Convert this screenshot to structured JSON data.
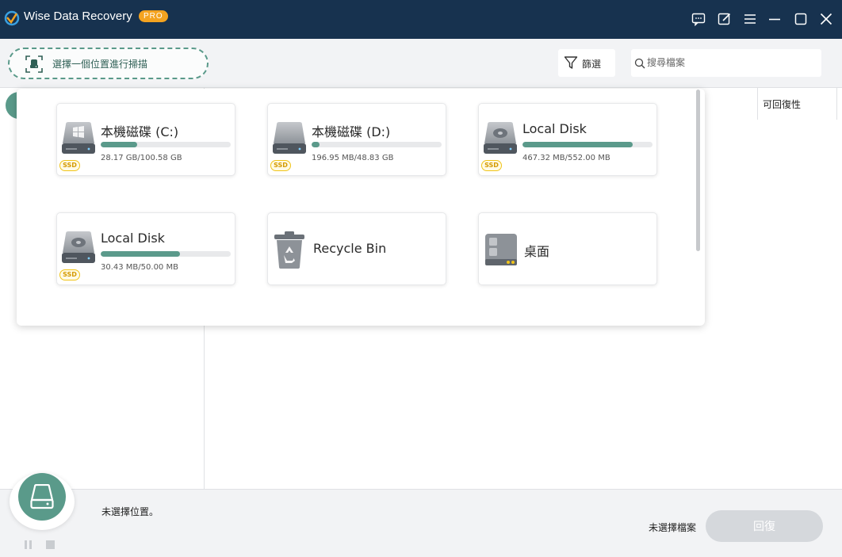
{
  "app": {
    "title": "Wise Data Recovery",
    "badge": "PRO"
  },
  "window_icons": [
    "feedback-icon",
    "edit-icon",
    "menu-icon",
    "minimize-icon",
    "maximize-icon",
    "close-icon"
  ],
  "toolbar": {
    "location_label": "選擇一個位置進行掃描",
    "filter_label": "篩選",
    "search_placeholder": "搜尋檔案"
  },
  "table": {
    "column_recoverability": "可回復性"
  },
  "drives": [
    {
      "name": "本機磁碟 (C:)",
      "size": "28.17 GB/100.58 GB",
      "usage": 0.28,
      "badge": "SSD",
      "icon": "windows-drive-icon"
    },
    {
      "name": "本機磁碟 (D:)",
      "size": "196.95 MB/48.83 GB",
      "usage": 0.06,
      "badge": "SSD",
      "icon": "hard-drive-icon"
    },
    {
      "name": "Local Disk",
      "size": "467.32 MB/552.00 MB",
      "usage": 0.85,
      "badge": "SSD",
      "icon": "hard-drive-icon"
    },
    {
      "name": "Local Disk",
      "size": "30.43 MB/50.00 MB",
      "usage": 0.61,
      "badge": "SSD",
      "icon": "hard-drive-icon"
    },
    {
      "name": "Recycle Bin",
      "icon": "recycle-bin-icon"
    },
    {
      "name": "桌面",
      "icon": "desktop-folder-icon"
    }
  ],
  "footer": {
    "status": "未選擇位置。",
    "selected_files": "未選擇檔案",
    "recover_label": "回復"
  },
  "colors": {
    "titlebar": "#17324f",
    "accent": "#5a9a8a",
    "badge": "#f4a320"
  }
}
